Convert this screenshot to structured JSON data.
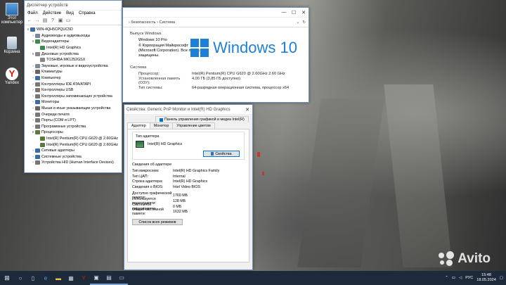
{
  "desktop": {
    "icons": [
      {
        "label": "Этот компьютер",
        "icon": "computer-icon"
      },
      {
        "label": "Корзина",
        "icon": "recycle-bin-icon"
      },
      {
        "label": "Yandex",
        "icon": "yandex-icon"
      }
    ]
  },
  "device_manager": {
    "title": "Диспетчер устройств",
    "menu": [
      "Файл",
      "Действие",
      "Вид",
      "Справка"
    ],
    "tree": [
      {
        "label": "WIN-4QH5CPQUC5D",
        "level": 0,
        "arrow": "∨",
        "color": "#3a6ea5"
      },
      {
        "label": "Аудиовходы и аудиовыходы",
        "level": 1,
        "arrow": "›",
        "color": "#7a8a99"
      },
      {
        "label": "Видеоадаптеры",
        "level": 1,
        "arrow": "∨",
        "color": "#3a8a4a"
      },
      {
        "label": "Intel(R) HD Graphics",
        "level": 2,
        "arrow": "",
        "color": "#3a8a4a"
      },
      {
        "label": "Дисковые устройства",
        "level": 1,
        "arrow": "∨",
        "color": "#888"
      },
      {
        "label": "TOSHIBA MK1252GSX",
        "level": 2,
        "arrow": "",
        "color": "#888"
      },
      {
        "label": "Звуковые, игровые и видеоустройства",
        "level": 1,
        "arrow": "›",
        "color": "#7a8a99"
      },
      {
        "label": "Клавиатуры",
        "level": 1,
        "arrow": "›",
        "color": "#666"
      },
      {
        "label": "Компьютер",
        "level": 1,
        "arrow": "›",
        "color": "#3a6ea5"
      },
      {
        "label": "Контроллеры IDE ATA/ATAPI",
        "level": 1,
        "arrow": "›",
        "color": "#777"
      },
      {
        "label": "Контроллеры USB",
        "level": 1,
        "arrow": "›",
        "color": "#777"
      },
      {
        "label": "Контроллеры запоминающих устройства",
        "level": 1,
        "arrow": "›",
        "color": "#777"
      },
      {
        "label": "Мониторы",
        "level": 1,
        "arrow": "›",
        "color": "#3a6ea5"
      },
      {
        "label": "Мыши и иные указывающие устройства",
        "level": 1,
        "arrow": "›",
        "color": "#666"
      },
      {
        "label": "Очереди печати",
        "level": 1,
        "arrow": "›",
        "color": "#777"
      },
      {
        "label": "Порты (COM и LPT)",
        "level": 1,
        "arrow": "›",
        "color": "#777"
      },
      {
        "label": "Программные устройства",
        "level": 1,
        "arrow": "›",
        "color": "#777"
      },
      {
        "label": "Процессоры",
        "level": 1,
        "arrow": "∨",
        "color": "#5a7a3a"
      },
      {
        "label": "Intel(R) Pentium(R) CPU G620 @ 2.60GHz",
        "level": 2,
        "arrow": "",
        "color": "#5a7a3a"
      },
      {
        "label": "Intel(R) Pentium(R) CPU G620 @ 2.60GHz",
        "level": 2,
        "arrow": "",
        "color": "#5a7a3a"
      },
      {
        "label": "Сетевые адаптеры",
        "level": 1,
        "arrow": "›",
        "color": "#3a6ea5"
      },
      {
        "label": "Системные устройства",
        "level": 1,
        "arrow": "›",
        "color": "#3a6ea5"
      },
      {
        "label": "Устройства HID (Human Interface Devices)",
        "level": 1,
        "arrow": "›",
        "color": "#777"
      }
    ]
  },
  "system_window": {
    "breadcrumb": "› безопасность › Система",
    "edition_title": "Выпуск Windows",
    "edition": "Windows 10 Pro",
    "copyright": "© Корпорация Майкрософт (Microsoft Corporation). Все права защищены.",
    "logo_text": "Windows 10",
    "system_title": "Система",
    "rows": [
      {
        "k": "Процессор:",
        "v": "Intel(R) Pentium(R) CPU G620 @ 2.60GHz   2.60 GHz"
      },
      {
        "k": "Установленная память (ОЗУ):",
        "v": "4,00 ГБ (3,85 ГБ доступно)"
      },
      {
        "k": "Тип системы:",
        "v": "64-разрядная операционная система, процессор x64"
      }
    ]
  },
  "properties": {
    "title": "Свойства: Generic PnP Monitor и Intel(R) HD Graphics",
    "tabs_row1": [
      "Панель управления графикой и медиа Intel(R)"
    ],
    "tabs_row2": [
      "Адаптер",
      "Монитор",
      "Управление цветом"
    ],
    "adapter_type_label": "Тип адаптера",
    "adapter_name": "Intel(R) HD Graphics",
    "properties_button": "Свойства",
    "info_title": "Сведения об адаптере",
    "info1": [
      {
        "k": "Тип микросхем:",
        "v": "Intel(R) HD Graphics Family"
      },
      {
        "k": "Тип ЦАП:",
        "v": "Internal"
      },
      {
        "k": "Строка адаптера:",
        "v": "Intel(R) HD Graphics"
      },
      {
        "k": "Сведения о BIOS:",
        "v": "Intel Video BIOS"
      }
    ],
    "info2": [
      {
        "k": "Доступно графической памяти:",
        "v": "1760 МБ"
      },
      {
        "k": "Используется видеопамяти:",
        "v": "128 МБ"
      },
      {
        "k": "Системной видеопамяти:",
        "v": "0 МБ"
      },
      {
        "k": "Общей системной памяти:",
        "v": "1632 МБ"
      }
    ],
    "list_modes_button": "Список всех режимов"
  },
  "taskbar": {
    "lang": "РУС",
    "time": "15:48",
    "date": "18.05.2024"
  },
  "watermark": "Avito"
}
